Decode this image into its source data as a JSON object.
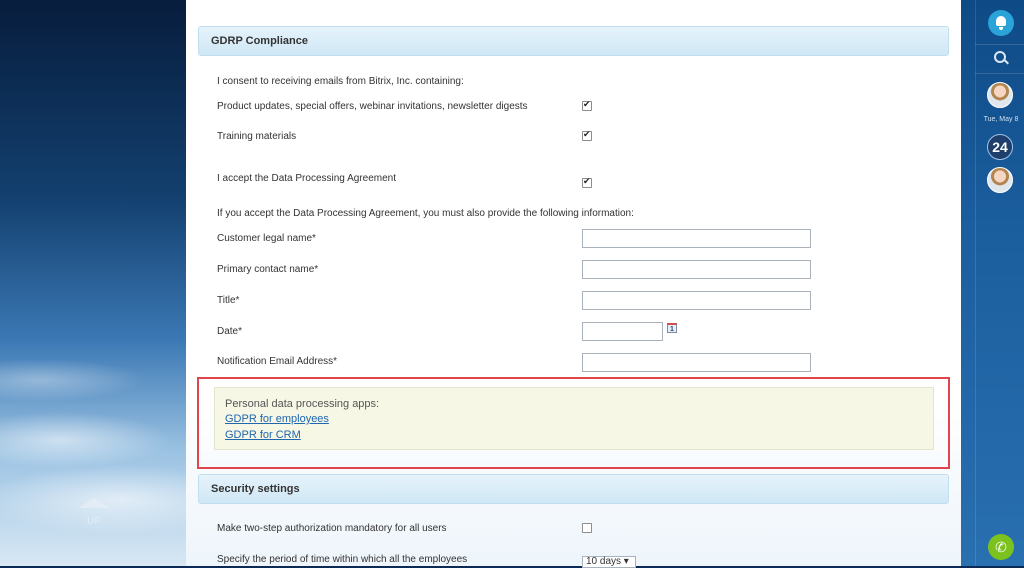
{
  "nav": {
    "up_label": "UP"
  },
  "gdpr": {
    "header": "GDRP Compliance",
    "consent_intro": "I consent to receiving emails from Bitrix, Inc. containing:",
    "opt_product_updates": "Product updates, special offers, webinar invitations, newsletter digests",
    "opt_training": "Training materials",
    "accept_dpa": "I accept the Data Processing Agreement",
    "dpa_note": "If you accept the Data Processing Agreement, you must also provide the following information:",
    "field_customer_legal_name": "Customer legal name*",
    "field_primary_contact": "Primary contact name*",
    "field_title": "Title*",
    "field_date": "Date*",
    "field_notification_email": "Notification Email Address*",
    "calendar_icon_text": "1"
  },
  "apps": {
    "title": "Personal data processing apps:",
    "link_employees": "GDPR for employees",
    "link_crm": "GDPR for CRM"
  },
  "security": {
    "header": "Security settings",
    "two_step": "Make two-step authorization mandatory for all users",
    "period_label": "Specify the period of time within which all the employees",
    "period_value": "10 days"
  },
  "sidebar": {
    "date_text": "Tue, May 8",
    "counter": "24"
  }
}
